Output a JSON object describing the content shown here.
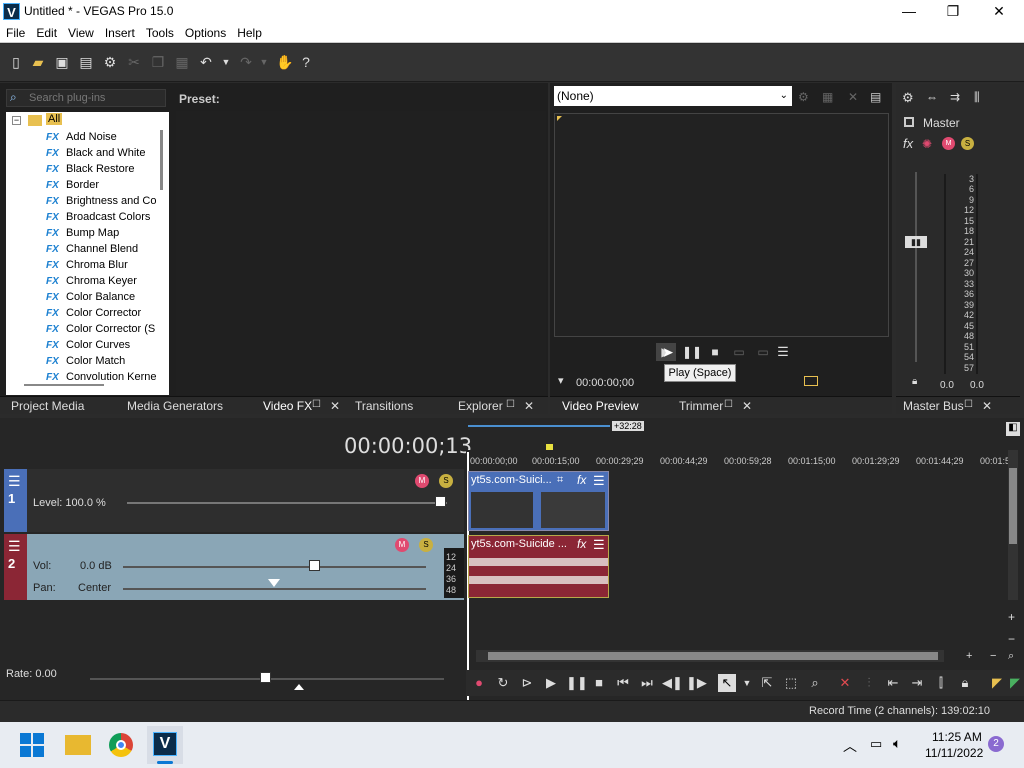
{
  "window": {
    "title": "Untitled * - VEGAS Pro 15.0",
    "app_icon_letter": "V",
    "minimize": "—",
    "maximize": "❐",
    "close": "✕"
  },
  "menu": [
    "File",
    "Edit",
    "View",
    "Insert",
    "Tools",
    "Options",
    "Help"
  ],
  "video_fx": {
    "search_placeholder": "Search plug-ins",
    "preset_label": "Preset:",
    "root": "All",
    "items": [
      "Add Noise",
      "Black and White",
      "Black Restore",
      "Border",
      "Brightness and Co",
      "Broadcast Colors",
      "Bump Map",
      "Channel Blend",
      "Chroma Blur",
      "Chroma Keyer",
      "Color Balance",
      "Color Corrector",
      "Color Corrector (S",
      "Color Curves",
      "Color Match",
      "Convolution Kerne"
    ],
    "fx_badge": "FX"
  },
  "left_tabs": [
    "Project Media",
    "Media Generators",
    "Video FX",
    "Transitions",
    "Explorer"
  ],
  "preview": {
    "dropdown_value": "(None)",
    "time": "00:00:00;00",
    "tooltip": "Play (Space)"
  },
  "preview_tabs": [
    "Video Preview",
    "Trimmer"
  ],
  "mixer": {
    "title": "Master",
    "scale": [
      "3",
      "6",
      "9",
      "12",
      "15",
      "18",
      "21",
      "24",
      "27",
      "30",
      "33",
      "36",
      "39",
      "42",
      "45",
      "48",
      "51",
      "54",
      "57"
    ],
    "left_value": "0.0",
    "right_value": "0.0",
    "tab": "Master Bus"
  },
  "timeline": {
    "time_display": "00:00:00;13",
    "selection_len": "+32:28",
    "ruler": [
      "00:00:00;00",
      "00:00:15;00",
      "00:00:29;29",
      "00:00:44;29",
      "00:00:59;28",
      "00:01:15;00",
      "00:01:29;29",
      "00:01:44;29",
      "00:01:5"
    ],
    "track1": {
      "number": "1",
      "level_label": "Level: 100.0 %"
    },
    "track2": {
      "number": "2",
      "vol_label": "Vol:",
      "vol_value": "0.0 dB",
      "pan_label": "Pan:",
      "pan_value": "Center",
      "meter_labels": [
        "12",
        "24",
        "36",
        "48"
      ]
    },
    "clip_video": "yt5s.com-Suici...",
    "clip_audio": "yt5s.com-Suicide ...",
    "rate": "Rate: 0.00"
  },
  "status": {
    "record_time": "Record Time (2 channels): 139:02:10"
  },
  "taskbar": {
    "time": "11:25 AM",
    "date": "11/11/2022",
    "notification_count": "2"
  }
}
